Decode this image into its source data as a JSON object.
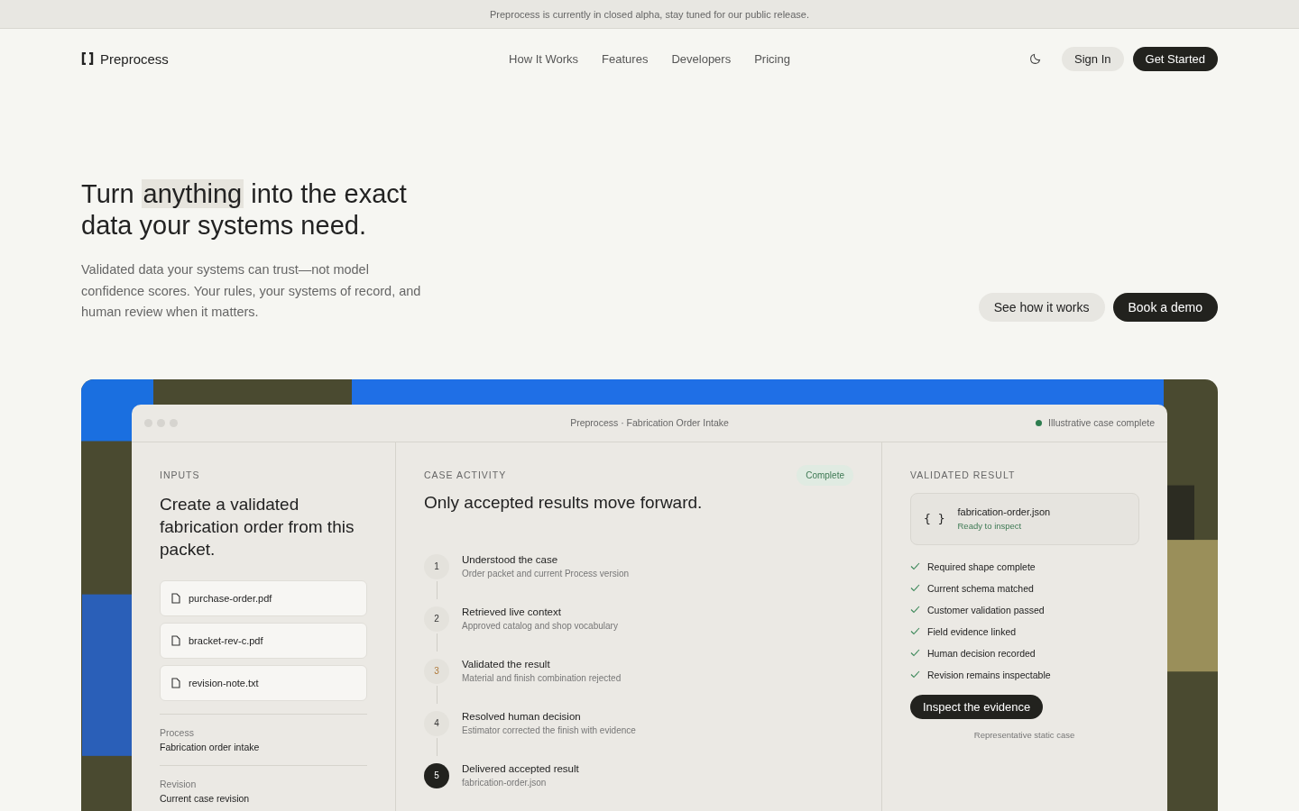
{
  "banner": "Preprocess is currently in closed alpha, stay tuned for our public release.",
  "nav": {
    "brand": "Preprocess",
    "links": [
      "How It Works",
      "Features",
      "Developers",
      "Pricing"
    ],
    "sign_in": "Sign In",
    "get_started": "Get Started"
  },
  "hero": {
    "headline_before": "Turn ",
    "headline_highlight": "anything",
    "headline_after": " into the exact data your systems need.",
    "subtitle": "Validated data your systems can trust—not model confidence scores. Your rules, your systems of record, and human review when it matters.",
    "secondary_button": "See how it works",
    "primary_button": "Book a demo"
  },
  "window": {
    "title": "Preprocess · Fabrication Order Intake",
    "status": "Illustrative case complete"
  },
  "inputs": {
    "label": "INPUTS",
    "heading": "Create a validated fabrication order from this packet.",
    "files": [
      "purchase-order.pdf",
      "bracket-rev-c.pdf",
      "revision-note.txt"
    ],
    "details": [
      {
        "label": "Process",
        "value": "Fabrication order intake"
      },
      {
        "label": "Revision",
        "value": "Current case revision"
      }
    ]
  },
  "activity": {
    "label": "CASE ACTIVITY",
    "badge": "Complete",
    "heading": "Only accepted results move forward.",
    "steps": [
      {
        "number": "1",
        "title": "Understood the case",
        "detail": "Order packet and current Process version",
        "kind": "done"
      },
      {
        "number": "2",
        "title": "Retrieved live context",
        "detail": "Approved catalog and shop vocabulary",
        "kind": "done"
      },
      {
        "number": "3",
        "title": "Validated the result",
        "detail": "Material and finish combination rejected",
        "kind": "warning"
      },
      {
        "number": "4",
        "title": "Resolved human decision",
        "detail": "Estimator corrected the finish with evidence",
        "kind": "done"
      },
      {
        "number": "5",
        "title": "Delivered accepted result",
        "detail": "fabrication-order.json",
        "kind": "current"
      }
    ]
  },
  "result": {
    "label": "VALIDATED RESULT",
    "file_icon": "{ }",
    "file": "fabrication-order.json",
    "file_status": "Ready to inspect",
    "checks": [
      {
        "text": "Required shape complete",
        "checked": true
      },
      {
        "text": "Current schema matched",
        "checked": true
      },
      {
        "text": "Customer validation passed",
        "checked": true
      },
      {
        "text": "Field evidence linked",
        "checked": true
      },
      {
        "text": "Human decision recorded",
        "checked": true
      },
      {
        "text": "Revision remains inspectable",
        "checked": true
      }
    ],
    "button": "Inspect the evidence",
    "note": "Representative static case"
  }
}
